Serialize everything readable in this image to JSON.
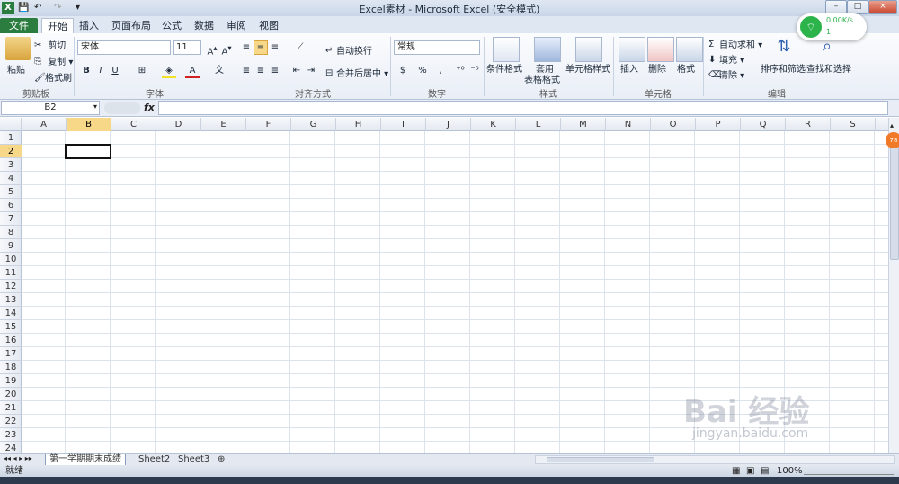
{
  "window": {
    "title": "Excel素材 - Microsoft Excel (安全模式)",
    "min": "–",
    "max": "□",
    "close": "×"
  },
  "tabs": [
    "文件",
    "开始",
    "插入",
    "页面布局",
    "公式",
    "数据",
    "审阅",
    "视图"
  ],
  "ribbon": {
    "clipboard": {
      "label": "剪贴板",
      "paste": "粘贴",
      "cut": "剪切",
      "copy": "复制",
      "format_painter": "格式刷"
    },
    "font": {
      "label": "字体",
      "name": "宋体",
      "size": "11",
      "bold": "B",
      "italic": "I",
      "underline": "U"
    },
    "alignment": {
      "label": "对齐方式",
      "wrap": "自动换行",
      "merge": "合并后居中"
    },
    "number": {
      "label": "数字",
      "format": "常规",
      "percent": "%"
    },
    "styles": {
      "label": "样式",
      "cond": "条件格式",
      "table": "套用",
      "table2": "表格格式",
      "cell": "单元格样式"
    },
    "cells": {
      "label": "单元格",
      "insert": "插入",
      "delete": "删除",
      "format": "格式"
    },
    "editing": {
      "label": "编辑",
      "autosum": "自动求和",
      "fill": "填充",
      "clear": "清除",
      "sort": "排序和筛选",
      "find": "查找和选择"
    }
  },
  "formula_bar": {
    "namebox": "B2",
    "fx": "fx",
    "value": ""
  },
  "grid": {
    "columns": [
      "A",
      "B",
      "C",
      "D",
      "E",
      "F",
      "G",
      "H",
      "I",
      "J",
      "K",
      "L",
      "M",
      "N",
      "O",
      "P",
      "Q",
      "R",
      "S"
    ],
    "rows": [
      "1",
      "2",
      "3",
      "4",
      "5",
      "6",
      "7",
      "8",
      "9",
      "10",
      "11",
      "12",
      "13",
      "14",
      "15",
      "16",
      "17",
      "18",
      "19",
      "20",
      "21",
      "22",
      "23",
      "24"
    ],
    "selected_col": "B",
    "selected_row": "2"
  },
  "sheets": [
    "第一学期期末成绩",
    "Sheet2",
    "Sheet3"
  ],
  "status": {
    "text": "就绪",
    "zoom": "100%"
  },
  "net_widget": {
    "speed": "0.00K/s",
    "count": "1"
  },
  "side_badge": "78",
  "watermark": {
    "logo": "Bai 经验",
    "url": "jingyan.baidu.com"
  },
  "colors": {
    "file_tab": "#2a7c3f",
    "selection_header": "#f7d888",
    "grid_line": "#dde3ea"
  }
}
